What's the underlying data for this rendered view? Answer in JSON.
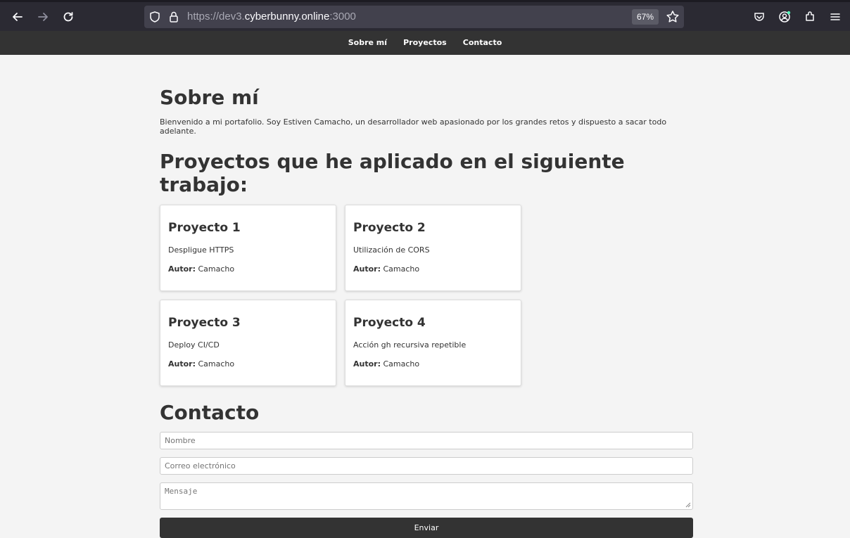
{
  "browser": {
    "url_prefix": "https://dev3.",
    "url_domain": "cyberbunny.online",
    "url_suffix": ":3000",
    "zoom": "67%"
  },
  "nav": {
    "items": [
      "Sobre mí",
      "Proyectos",
      "Contacto"
    ]
  },
  "about": {
    "title": "Sobre mí",
    "text": "Bienvenido a mi portafolio. Soy Estiven Camacho, un desarrollador web apasionado por los grandes retos y dispuesto a sacar todo adelante."
  },
  "projects": {
    "title": "Proyectos que he aplicado en el siguiente trabajo:",
    "author_label": "Autor:",
    "items": [
      {
        "title": "Proyecto 1",
        "desc": "Despligue HTTPS",
        "author": "Camacho"
      },
      {
        "title": "Proyecto 2",
        "desc": "Utilización de CORS",
        "author": "Camacho"
      },
      {
        "title": "Proyecto 3",
        "desc": "Deploy CI/CD",
        "author": "Camacho"
      },
      {
        "title": "Proyecto 4",
        "desc": "Acción gh recursiva repetible",
        "author": "Camacho"
      }
    ]
  },
  "contact": {
    "title": "Contacto",
    "name_placeholder": "Nombre",
    "email_placeholder": "Correo electrónico",
    "message_placeholder": "Mensaje",
    "submit_label": "Enviar"
  },
  "colors": {
    "nav_bg": "#333333",
    "page_bg": "#f4f4f4",
    "button_bg": "#333333"
  }
}
